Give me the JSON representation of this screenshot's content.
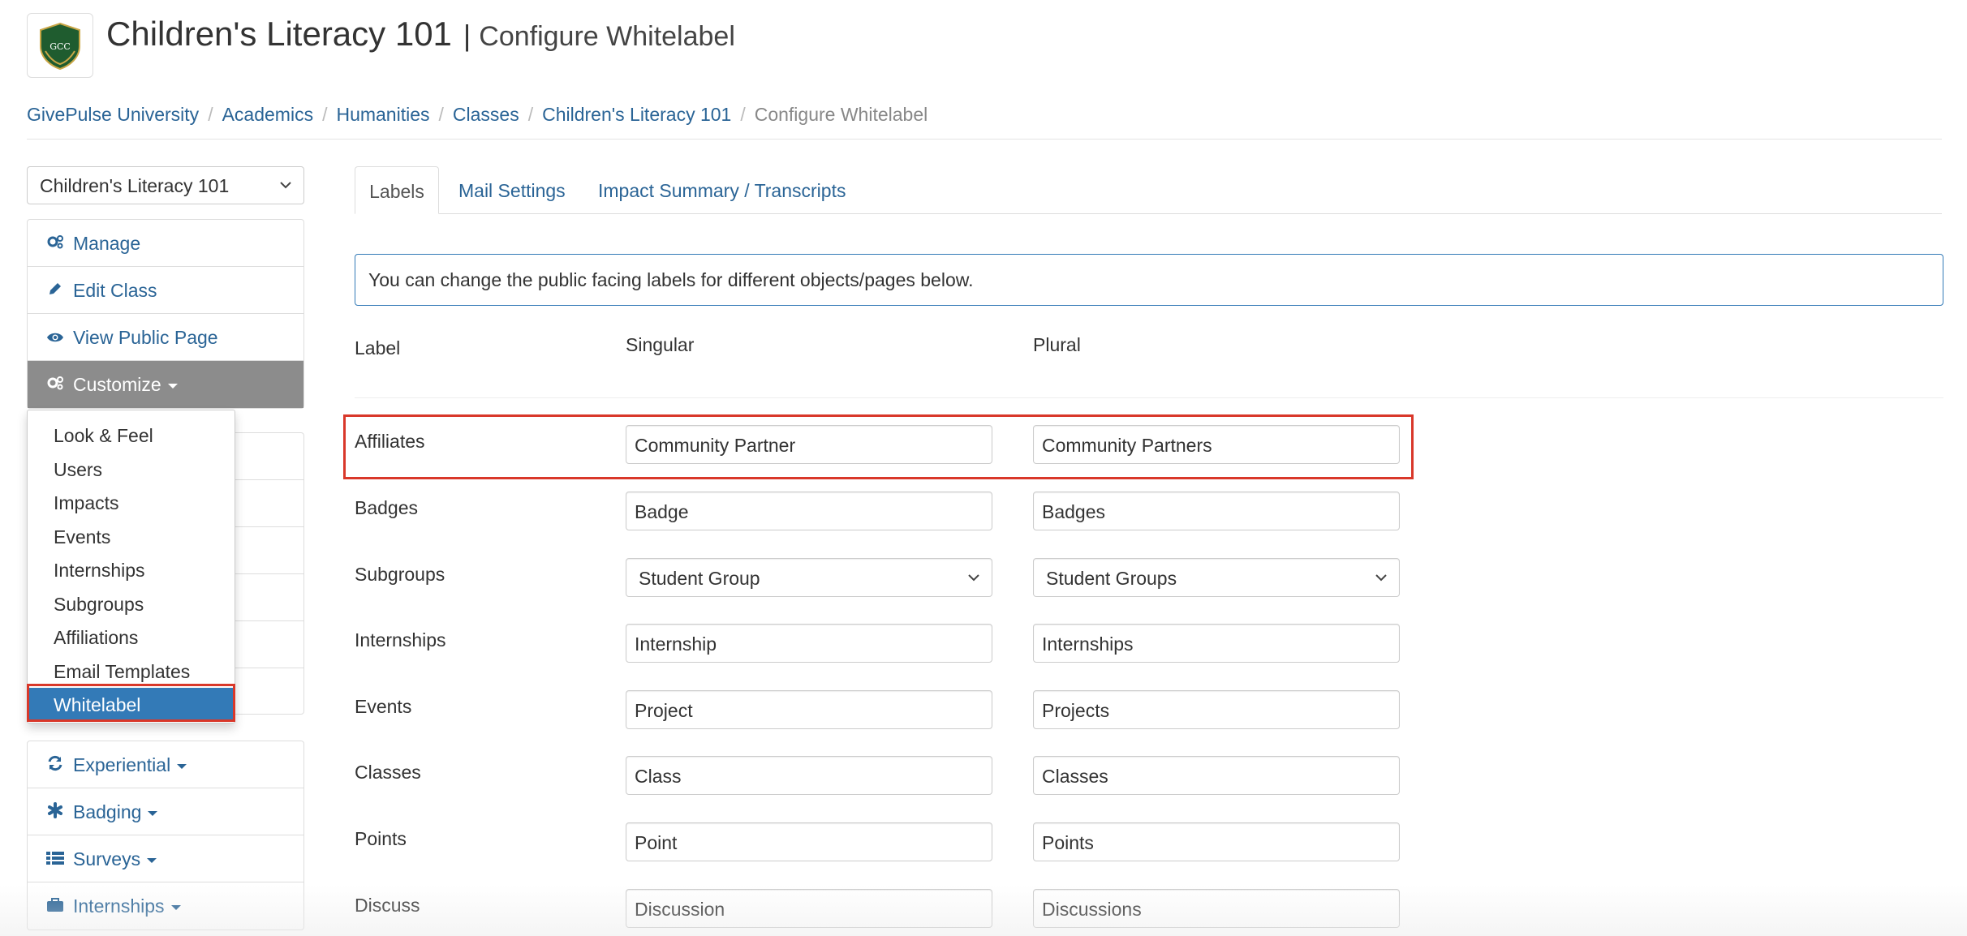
{
  "header": {
    "logo_text": "GCC",
    "title": "Children's Literacy 101",
    "separator": "|",
    "subtitle": "Configure Whitelabel"
  },
  "breadcrumb": [
    "GivePulse University",
    "Academics",
    "Humanities",
    "Classes",
    "Children's Literacy 101",
    "Configure Whitelabel"
  ],
  "sidebar": {
    "class_select": "Children's Literacy 101",
    "top_items": [
      {
        "label": "Manage",
        "icon": "gears-icon"
      },
      {
        "label": "Edit Class",
        "icon": "pencil-icon"
      },
      {
        "label": "View Public Page",
        "icon": "eye-icon"
      },
      {
        "label": "Customize",
        "icon": "gears-icon"
      }
    ],
    "customize_menu": [
      "Look & Feel",
      "Users",
      "Impacts",
      "Events",
      "Internships",
      "Subgroups",
      "Affiliations",
      "Email Templates",
      "Whitelabel"
    ],
    "bottom_items": [
      {
        "label": "Experiential",
        "icon": "refresh-icon"
      },
      {
        "label": "Badging",
        "icon": "asterisk-icon"
      },
      {
        "label": "Surveys",
        "icon": "list-icon"
      },
      {
        "label": "Internships",
        "icon": "briefcase-icon"
      }
    ]
  },
  "tabs": [
    "Labels",
    "Mail Settings",
    "Impact Summary / Transcripts"
  ],
  "info_text": "You can change the public facing labels for different objects/pages below.",
  "columns": {
    "label": "Label",
    "singular": "Singular",
    "plural": "Plural"
  },
  "rows": [
    {
      "label": "Affiliates",
      "singular": "Community Partner",
      "plural": "Community Partners"
    },
    {
      "label": "Badges",
      "singular": "Badge",
      "plural": "Badges"
    },
    {
      "label": "Subgroups",
      "singular": "Student Group",
      "plural": "Student Groups"
    },
    {
      "label": "Internships",
      "singular": "Internship",
      "plural": "Internships"
    },
    {
      "label": "Events",
      "singular": "Project",
      "plural": "Projects"
    },
    {
      "label": "Classes",
      "singular": "Class",
      "plural": "Classes"
    },
    {
      "label": "Points",
      "singular": "Point",
      "plural": "Points"
    },
    {
      "label": "Discuss",
      "singular": "Discussion",
      "plural": "Discussions"
    }
  ],
  "colors": {
    "link": "#2a6496",
    "active_menu": "#337ab7",
    "highlight": "#d9382a",
    "sidebar_active": "#8c8c8c"
  }
}
